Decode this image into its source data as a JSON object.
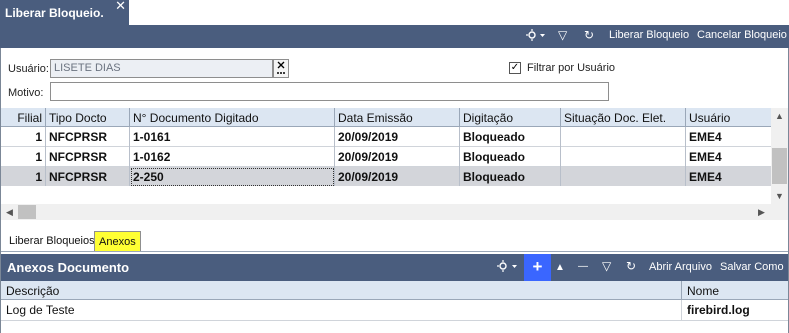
{
  "window": {
    "tab_title": "Liberar Bloqueio.",
    "close_glyph": "✕"
  },
  "toolbar": {
    "filter_glyph": "▽",
    "refresh_glyph": "↻",
    "liberar_label": "Liberar Bloqueio",
    "cancelar_label": "Cancelar Bloqueio"
  },
  "form": {
    "usuario_label": "Usuário:",
    "usuario_value": "LISETE DIAS",
    "lookup_glyph": "✕…",
    "filtrar_label": "Filtrar por Usuário",
    "filtrar_checked": "✓",
    "motivo_label": "Motivo:",
    "motivo_value": ""
  },
  "grid": {
    "columns": [
      "Filial",
      "Tipo Docto",
      "N° Documento Digitado",
      "Data Emissão",
      "Digitação",
      "Situação Doc. Elet.",
      "Usuário"
    ],
    "rows": [
      {
        "filial": "1",
        "tipo": "NFCPRSR",
        "numero": "1-0161",
        "data": "20/09/2019",
        "digitacao": "Bloqueado",
        "situacao": "",
        "usuario": "EME4"
      },
      {
        "filial": "1",
        "tipo": "NFCPRSR",
        "numero": "1-0162",
        "data": "20/09/2019",
        "digitacao": "Bloqueado",
        "situacao": "",
        "usuario": "EME4"
      },
      {
        "filial": "1",
        "tipo": "NFCPRSR",
        "numero": "2-250",
        "data": "20/09/2019",
        "digitacao": "Bloqueado",
        "situacao": "",
        "usuario": "EME4"
      }
    ]
  },
  "subtabs": {
    "liberar": "Liberar Bloqueios",
    "anexos": "Anexos"
  },
  "anexos_panel": {
    "title": "Anexos Documento",
    "add_glyph": "+",
    "up_glyph": "▲",
    "remove_glyph": "—",
    "filter_glyph": "▽",
    "refresh_glyph": "↻",
    "abrir_label": "Abrir Arquivo",
    "salvar_label": "Salvar Como"
  },
  "anexos_grid": {
    "columns": [
      "Descrição",
      "Nome"
    ],
    "rows": [
      {
        "descricao": "Log de Teste",
        "nome": "firebird.log"
      }
    ]
  },
  "colors": {
    "header_bg": "#4a5d7e",
    "grid_header_bg": "#dce6f2",
    "active_subtab": "#ffff33",
    "add_button": "#3a66ff"
  }
}
